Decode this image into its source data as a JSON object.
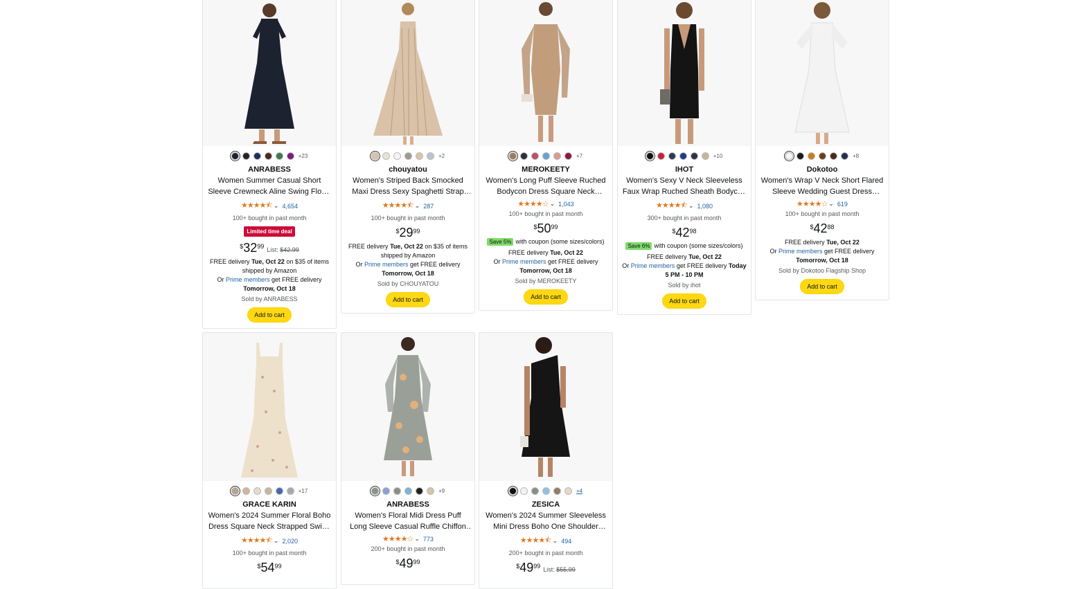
{
  "products": [
    {
      "brand": "ANRABESS",
      "title": "Women Summer Casual Short Sleeve Crewneck Aline Swing Flowy Tiered...",
      "rating_stars": "★★★★⯪",
      "rating_count": "4,654",
      "bought": "100+ bought in past month",
      "deal": "Limited time deal",
      "price_currency": "$",
      "price_whole": "32",
      "price_cents": "99",
      "list_label": "List:",
      "list_price": "$42.99",
      "swatch_colors": [
        "#1c2230",
        "#222222",
        "#1f2f5c",
        "#4a2b1c",
        "#3f7a4a",
        "#7a1f7a"
      ],
      "more_colors": "+23",
      "delivery_lines": [
        "FREE delivery Tue, Oct 22 on $35 of items",
        "shipped by Amazon",
        "Or Prime members get FREE delivery",
        "Tomorrow, Oct 18"
      ],
      "sold_by": "Sold by ANRABESS",
      "cart": "Add to cart"
    },
    {
      "brand": "chouyatou",
      "title": "Women's Striped Back Smocked Maxi Dress Sexy Spaghetti Strap Cut Out...",
      "rating_stars": "★★★★⯪",
      "rating_count": "287",
      "bought": "100+ bought in past month",
      "price_currency": "$",
      "price_whole": "29",
      "price_cents": "99",
      "swatch_colors": [
        "#d9c2a7",
        "#e8e2d8",
        "#f4f4f4",
        "#9d9a92",
        "#d7c5a9",
        "#b8c4cf"
      ],
      "more_colors": "+2",
      "delivery_lines": [
        "FREE delivery Tue, Oct 22 on $35 of items",
        "shipped by Amazon",
        "Or Prime members get FREE delivery",
        "Tomorrow, Oct 18"
      ],
      "sold_by": "Sold by CHOUYATOU",
      "cart": "Add to cart"
    },
    {
      "brand": "MEROKEETY",
      "title": "Women's Long Puff Sleeve Ruched Bodycon Dress Square Neck Mesh...",
      "rating_stars": "★★★★☆",
      "rating_count": "1,043",
      "bought": "100+ bought in past month",
      "price_currency": "$",
      "price_whole": "50",
      "price_cents": "99",
      "coupon_badge": "Save 5%",
      "coupon_text": "with coupon (some sizes/colors)",
      "swatch_colors": [
        "#a27b5c",
        "#2a2f3a",
        "#c0506a",
        "#6aa0d8",
        "#d89a8f",
        "#8a1c3a"
      ],
      "more_colors": "+7",
      "delivery_lines": [
        "FREE delivery Tue, Oct 22",
        "Or Prime members get FREE delivery",
        "Tomorrow, Oct 18"
      ],
      "sold_by": "Sold by MEROKEETY",
      "cart": "Add to cart"
    },
    {
      "brand": "IHOT",
      "title": "Women's Sexy V Neck Sleeveless Faux Wrap Ruched Sheath Bodycon Casua...",
      "rating_stars": "★★★★⯪",
      "rating_count": "1,080",
      "bought": "300+ bought in past month",
      "price_currency": "$",
      "price_whole": "42",
      "price_cents": "98",
      "coupon_badge": "Save 6%",
      "coupon_text": "with coupon (some sizes/colors)",
      "swatch_colors": [
        "#111111",
        "#c8203a",
        "#2b3a55",
        "#1f3b8a",
        "#2c3446",
        "#c9b49a"
      ],
      "more_colors": "+10",
      "delivery_lines": [
        "FREE delivery Tue, Oct 22",
        "Or Prime members get FREE delivery Today",
        "5 PM - 10 PM"
      ],
      "sold_by": "Sold by ihot",
      "cart": "Add to cart"
    },
    {
      "brand": "Dokotoo",
      "title": "Women's Wrap V Neck Short Flared Sleeve Wedding Guest Dress Smocke...",
      "rating_stars": "★★★★☆",
      "rating_count": "619",
      "bought": "100+ bought in past month",
      "price_currency": "$",
      "price_whole": "42",
      "price_cents": "88",
      "swatch_colors": [
        "#f6f6f6",
        "#1b1b1b",
        "#c87d1a",
        "#6b3e1f",
        "#4a2a1c",
        "#22304d"
      ],
      "more_colors": "+8",
      "delivery_lines": [
        "FREE delivery Tue, Oct 22",
        "Or Prime members get FREE delivery",
        "Tomorrow, Oct 18"
      ],
      "sold_by": "Sold by Dokotoo Flagship Shop",
      "cart": "Add to cart"
    },
    {
      "brand": "GRACE KARIN",
      "title": "Women's 2024 Summer Floral Boho Dress Square Neck Strapped Swing A...",
      "rating_stars": "★★★★⯪",
      "rating_count": "2,020",
      "bought": "100+ bought in past month",
      "price_currency": "$",
      "price_whole": "54",
      "price_cents": "99",
      "swatch_colors": [
        "#b9a38a",
        "#d4b49a",
        "#e7dccb",
        "#c7b79a",
        "#4a66a8",
        "#a7a8ad"
      ],
      "more_colors": "+17"
    },
    {
      "brand": "ANRABESS",
      "title": "Women's Floral Midi Dress Puff Long Sleeve Casual Ruffle Chiffon A-Line...",
      "rating_stars": "★★★★☆",
      "rating_count": "773",
      "bought": "200+ bought in past month",
      "price_currency": "$",
      "price_whole": "49",
      "price_cents": "99",
      "swatch_colors": [
        "#8e9187",
        "#8a9fd8",
        "#8c8d8a",
        "#7fb2d9",
        "#222222",
        "#d6c5a8"
      ],
      "more_colors": "+9"
    },
    {
      "brand": "ZESICA",
      "title": "Women's 2024 Summer Sleeveless Mini Dress Boho One Shoulder Ruffle...",
      "rating_stars": "★★★★⯪",
      "rating_count": "494",
      "bought": "200+ bought in past month",
      "price_currency": "$",
      "price_whole": "49",
      "price_cents": "99",
      "list_label": "List:",
      "list_price": "$55.99",
      "swatch_colors": [
        "#111111",
        "#f2f2f2",
        "#8b8d8c",
        "#8ec0ea",
        "#8f7d66",
        "#ead7c2"
      ],
      "more_colors": "+4"
    }
  ]
}
